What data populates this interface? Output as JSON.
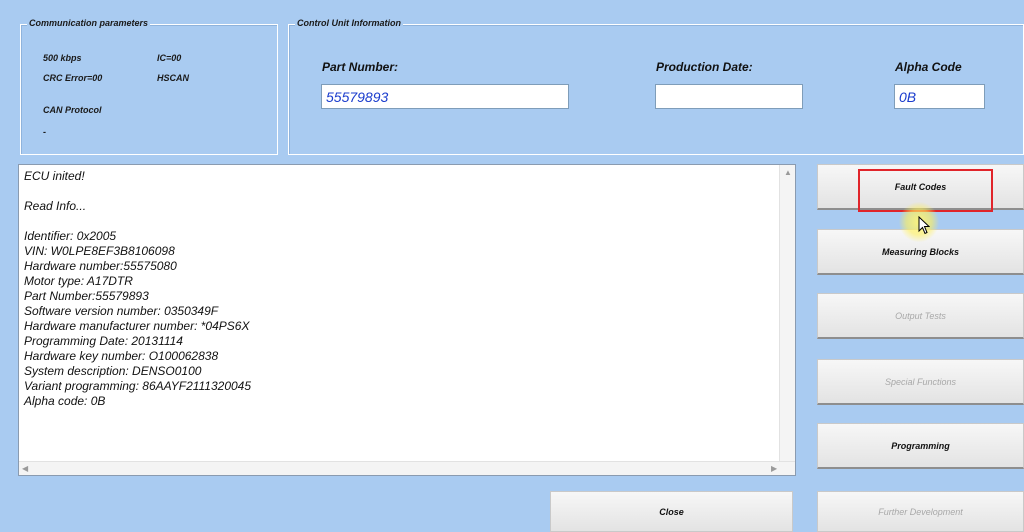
{
  "comm_params": {
    "title": "Communication parameters",
    "speed": "500 kbps",
    "ic": "IC=00",
    "crc": "CRC Error=00",
    "bus": "HSCAN",
    "protocol": "CAN Protocol",
    "protocol_value": "-"
  },
  "control_unit": {
    "title": "Control Unit Information",
    "part_number_label": "Part Number:",
    "part_number_value": "55579893",
    "production_date_label": "Production Date:",
    "production_date_value": "",
    "alpha_code_label": "Alpha Code",
    "alpha_code_value": "0B"
  },
  "log": {
    "lines": [
      "ECU inited!",
      "",
      "Read Info...",
      "",
      "Identifier: 0x2005",
      "VIN: W0LPE8EF3B8106098",
      "Hardware number:55575080",
      "Motor type: A17DTR",
      "Part Number:55579893",
      "Software version number: 0350349F",
      "Hardware manufacturer number: *04PS6X",
      "Programming Date: 20131114",
      "Hardware key number: O100062838",
      "System description: DENSO0100",
      "Variant programming: 86AAYF2111320045",
      "Alpha code: 0B"
    ]
  },
  "buttons": {
    "fault_codes": "Fault Codes",
    "measuring_blocks": "Measuring Blocks",
    "output_tests": "Output Tests",
    "special_functions": "Special Functions",
    "programming": "Programming",
    "further_development": "Further Development",
    "close": "Close"
  },
  "colors": {
    "background": "#a9cbf1",
    "input_text": "#1a3ccd",
    "highlight": "#e0242a",
    "disabled_text": "#a8a8a8"
  }
}
